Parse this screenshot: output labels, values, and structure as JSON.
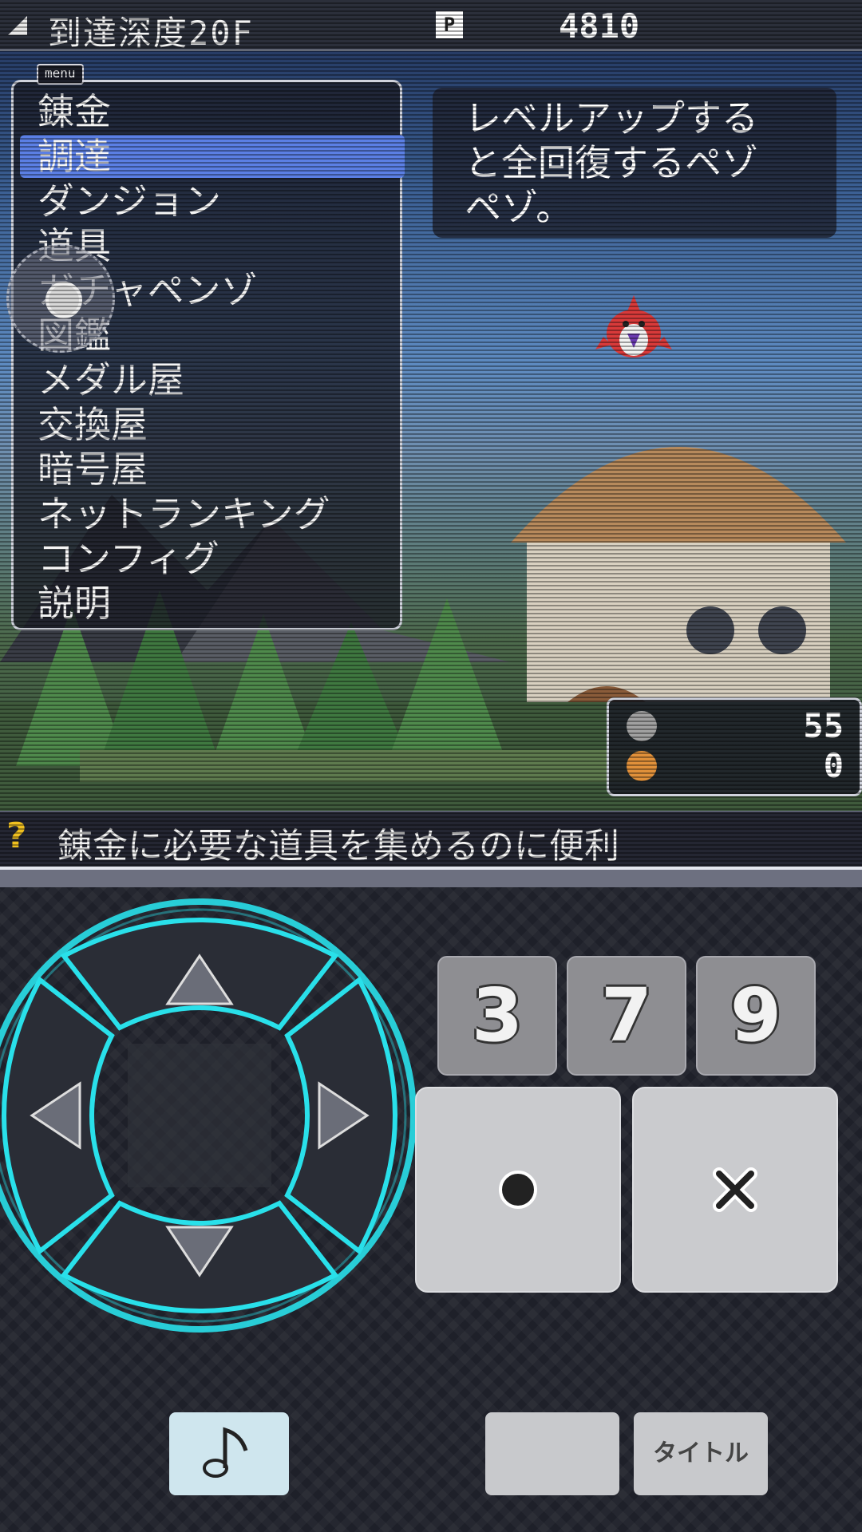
{
  "header": {
    "depth_label": "到達深度20F",
    "points_icon": "P",
    "money": "4810"
  },
  "menu": {
    "label": "menu",
    "items": [
      "錬金",
      "調達",
      "ダンジョン",
      "道具",
      "ガチャペンゾ",
      "図鑑",
      "メダル屋",
      "交換屋",
      "暗号屋",
      "ネットランキング",
      "コンフィグ",
      "説明"
    ],
    "selected_index": 1
  },
  "speech": {
    "text_line1": "レベルアップする",
    "text_line2": "と全回復するペゾ",
    "text_line3": "ペゾ。"
  },
  "resources": {
    "gear_value": "55",
    "coin_value": "0",
    "gear_color": "#a0a0a0",
    "coin_color": "#e0903a"
  },
  "hint": {
    "icon": "?",
    "text": "錬金に必要な道具を集めるのに便利"
  },
  "controller": {
    "num_keys": [
      "3",
      "7",
      "9"
    ],
    "circle_key": "circle-icon",
    "cross_key": "cross-icon",
    "music_button": "music-note-icon",
    "title_button": "タイトル",
    "dpad_glow_color": "#29e0ea"
  }
}
